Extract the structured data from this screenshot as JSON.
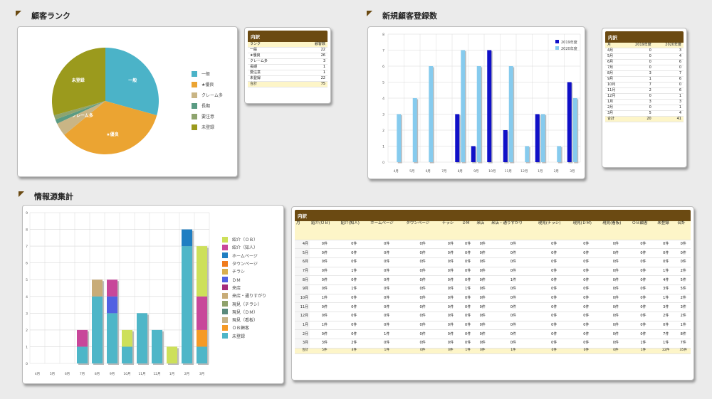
{
  "sections": {
    "rank_title": "顧客ランク",
    "new_title": "新規顧客登録数",
    "info_title": "情報源集計"
  },
  "rank_table": {
    "header": "内訳",
    "columns": [
      "ランク",
      "顧客数"
    ],
    "rows": [
      [
        "一般",
        "22"
      ],
      [
        "★優良",
        "26"
      ],
      [
        "クレーム多",
        "3"
      ],
      [
        "長期",
        "1"
      ],
      [
        "要注意",
        "1"
      ],
      [
        "未登録",
        "22"
      ]
    ],
    "total": [
      "合計",
      "75"
    ]
  },
  "new_table": {
    "header": "内訳",
    "columns": [
      "月",
      "2019年度",
      "2020年度"
    ],
    "rows": [
      [
        "4月",
        "0",
        "3"
      ],
      [
        "5月",
        "0",
        "4"
      ],
      [
        "6月",
        "0",
        "6"
      ],
      [
        "7月",
        "0",
        "0"
      ],
      [
        "8月",
        "3",
        "7"
      ],
      [
        "9月",
        "1",
        "6"
      ],
      [
        "10月",
        "7",
        "0"
      ],
      [
        "11月",
        "2",
        "6"
      ],
      [
        "12月",
        "0",
        "1"
      ],
      [
        "1月",
        "3",
        "3"
      ],
      [
        "2月",
        "0",
        "1"
      ],
      [
        "3月",
        "5",
        "4"
      ]
    ],
    "total": [
      "合計",
      "20",
      "41"
    ]
  },
  "info_table": {
    "header": "内訳",
    "columns": [
      "月",
      "紹介(ＯＢ)",
      "紹介(知人)",
      "ホームページ",
      "タウンページ",
      "チラシ",
      "ＤＭ",
      "来店",
      "来店・通りすがり",
      "現見(チラシ)",
      "現見(ＤＭ)",
      "現見(看板)",
      "ＯＢ顧客",
      "未登録",
      "合計"
    ],
    "rows": [
      [
        "4月",
        "0件",
        "0件",
        "0件",
        "0件",
        "0件",
        "0件",
        "0件",
        "0件",
        "0件",
        "0件",
        "0件",
        "0件",
        "0件",
        "0件"
      ],
      [
        "5月",
        "0件",
        "0件",
        "0件",
        "0件",
        "0件",
        "0件",
        "0件",
        "0件",
        "0件",
        "0件",
        "0件",
        "0件",
        "0件",
        "0件"
      ],
      [
        "6月",
        "0件",
        "0件",
        "0件",
        "0件",
        "0件",
        "0件",
        "0件",
        "0件",
        "0件",
        "0件",
        "0件",
        "0件",
        "0件",
        "0件"
      ],
      [
        "7月",
        "0件",
        "1件",
        "0件",
        "0件",
        "0件",
        "0件",
        "0件",
        "0件",
        "0件",
        "0件",
        "0件",
        "0件",
        "1件",
        "2件"
      ],
      [
        "8月",
        "0件",
        "0件",
        "0件",
        "0件",
        "0件",
        "0件",
        "0件",
        "1件",
        "0件",
        "0件",
        "0件",
        "0件",
        "4件",
        "5件"
      ],
      [
        "9月",
        "0件",
        "1件",
        "0件",
        "0件",
        "0件",
        "1件",
        "0件",
        "0件",
        "0件",
        "0件",
        "0件",
        "0件",
        "3件",
        "5件"
      ],
      [
        "10月",
        "1件",
        "0件",
        "0件",
        "0件",
        "0件",
        "0件",
        "0件",
        "0件",
        "0件",
        "0件",
        "0件",
        "0件",
        "1件",
        "2件"
      ],
      [
        "11月",
        "0件",
        "0件",
        "0件",
        "0件",
        "0件",
        "0件",
        "0件",
        "0件",
        "0件",
        "0件",
        "0件",
        "0件",
        "3件",
        "3件"
      ],
      [
        "12月",
        "0件",
        "0件",
        "0件",
        "0件",
        "0件",
        "0件",
        "0件",
        "0件",
        "0件",
        "0件",
        "0件",
        "0件",
        "2件",
        "2件"
      ],
      [
        "1月",
        "1件",
        "0件",
        "0件",
        "0件",
        "0件",
        "0件",
        "0件",
        "0件",
        "0件",
        "0件",
        "0件",
        "0件",
        "0件",
        "1件"
      ],
      [
        "2月",
        "0件",
        "0件",
        "1件",
        "0件",
        "0件",
        "0件",
        "0件",
        "0件",
        "0件",
        "0件",
        "0件",
        "0件",
        "7件",
        "8件"
      ],
      [
        "3月",
        "3件",
        "2件",
        "0件",
        "0件",
        "0件",
        "0件",
        "0件",
        "0件",
        "0件",
        "0件",
        "0件",
        "1件",
        "1件",
        "7件"
      ]
    ],
    "total": [
      "合計",
      "5件",
      "4件",
      "1件",
      "0件",
      "0件",
      "1件",
      "0件",
      "1件",
      "0件",
      "0件",
      "0件",
      "1件",
      "22件",
      "35件"
    ]
  },
  "chart_data": [
    {
      "type": "pie",
      "categories": [
        "一般",
        "★優良",
        "クレーム多",
        "長期",
        "要注意",
        "未登録"
      ],
      "values": [
        22,
        26,
        3,
        1,
        1,
        22
      ],
      "colors": [
        "#4bb3c8",
        "#eba432",
        "#c9b585",
        "#5a9b82",
        "#8ea46e",
        "#9b9a1d"
      ],
      "slice_labels": [
        "一般",
        "★優良",
        "クレーム多",
        "",
        "",
        "未登録"
      ]
    },
    {
      "type": "bar",
      "categories": [
        "4月",
        "5月",
        "6月",
        "7月",
        "8月",
        "9月",
        "10月",
        "11月",
        "12月",
        "1月",
        "2月",
        "3月"
      ],
      "series": [
        {
          "name": "2019年度",
          "values": [
            0,
            0,
            0,
            0,
            3,
            1,
            7,
            2,
            0,
            3,
            0,
            5
          ],
          "color": "#1010c8"
        },
        {
          "name": "2020年度",
          "values": [
            3,
            4,
            6,
            0,
            7,
            6,
            0,
            6,
            1,
            3,
            1,
            4
          ],
          "color": "#86cbee"
        }
      ],
      "ylim": [
        0,
        8
      ],
      "yticks": [
        0,
        1,
        2,
        3,
        4,
        5,
        6,
        7,
        8
      ],
      "legend": "top-right",
      "grid": true
    },
    {
      "type": "bar",
      "stacked": true,
      "categories": [
        "4月",
        "5月",
        "6月",
        "7月",
        "8月",
        "9月",
        "10月",
        "11月",
        "12月",
        "1月",
        "2月",
        "3月"
      ],
      "series": [
        {
          "name": "紹介（ＯＢ）",
          "values": [
            0,
            0,
            0,
            0,
            0,
            0,
            1,
            0,
            0,
            1,
            0,
            3
          ],
          "color": "#cde05a"
        },
        {
          "name": "紹介（知人）",
          "values": [
            0,
            0,
            0,
            1,
            0,
            1,
            0,
            0,
            0,
            0,
            0,
            2
          ],
          "color": "#c8479a"
        },
        {
          "name": "ホームページ",
          "values": [
            0,
            0,
            0,
            0,
            0,
            0,
            0,
            0,
            0,
            0,
            1,
            0
          ],
          "color": "#1f7ec2"
        },
        {
          "name": "タウンページ",
          "values": [
            0,
            0,
            0,
            0,
            0,
            0,
            0,
            0,
            0,
            0,
            0,
            0
          ],
          "color": "#f07b1c"
        },
        {
          "name": "チラシ",
          "values": [
            0,
            0,
            0,
            0,
            0,
            0,
            0,
            0,
            0,
            0,
            0,
            0
          ],
          "color": "#d8ae4f"
        },
        {
          "name": "ＤＭ",
          "values": [
            0,
            0,
            0,
            0,
            0,
            1,
            0,
            0,
            0,
            0,
            0,
            0
          ],
          "color": "#5161e2"
        },
        {
          "name": "来店",
          "values": [
            0,
            0,
            0,
            0,
            0,
            0,
            0,
            0,
            0,
            0,
            0,
            0
          ],
          "color": "#a52c7c"
        },
        {
          "name": "来店・通りすがり",
          "values": [
            0,
            0,
            0,
            0,
            1,
            0,
            0,
            0,
            0,
            0,
            0,
            0
          ],
          "color": "#c8ac78"
        },
        {
          "name": "現見（チラシ）",
          "values": [
            0,
            0,
            0,
            0,
            0,
            0,
            0,
            0,
            0,
            0,
            0,
            0
          ],
          "color": "#8fa26c"
        },
        {
          "name": "現見（ＤＭ）",
          "values": [
            0,
            0,
            0,
            0,
            0,
            0,
            0,
            0,
            0,
            0,
            0,
            0
          ],
          "color": "#5a8a7d"
        },
        {
          "name": "現見（看板）",
          "values": [
            0,
            0,
            0,
            0,
            0,
            0,
            0,
            0,
            0,
            0,
            0,
            0
          ],
          "color": "#c5b388"
        },
        {
          "name": "ＯＢ顧客",
          "values": [
            0,
            0,
            0,
            0,
            0,
            0,
            0,
            0,
            0,
            0,
            0,
            1
          ],
          "color": "#f59a25"
        },
        {
          "name": "未登録",
          "values": [
            0,
            0,
            0,
            1,
            4,
            3,
            1,
            3,
            2,
            0,
            7,
            1
          ],
          "color": "#4eb6c8"
        }
      ],
      "ylim": [
        0,
        9
      ],
      "yticks": [
        0,
        1,
        2,
        3,
        4,
        5,
        6,
        7,
        8,
        9
      ],
      "legend": "right",
      "grid": true
    }
  ]
}
